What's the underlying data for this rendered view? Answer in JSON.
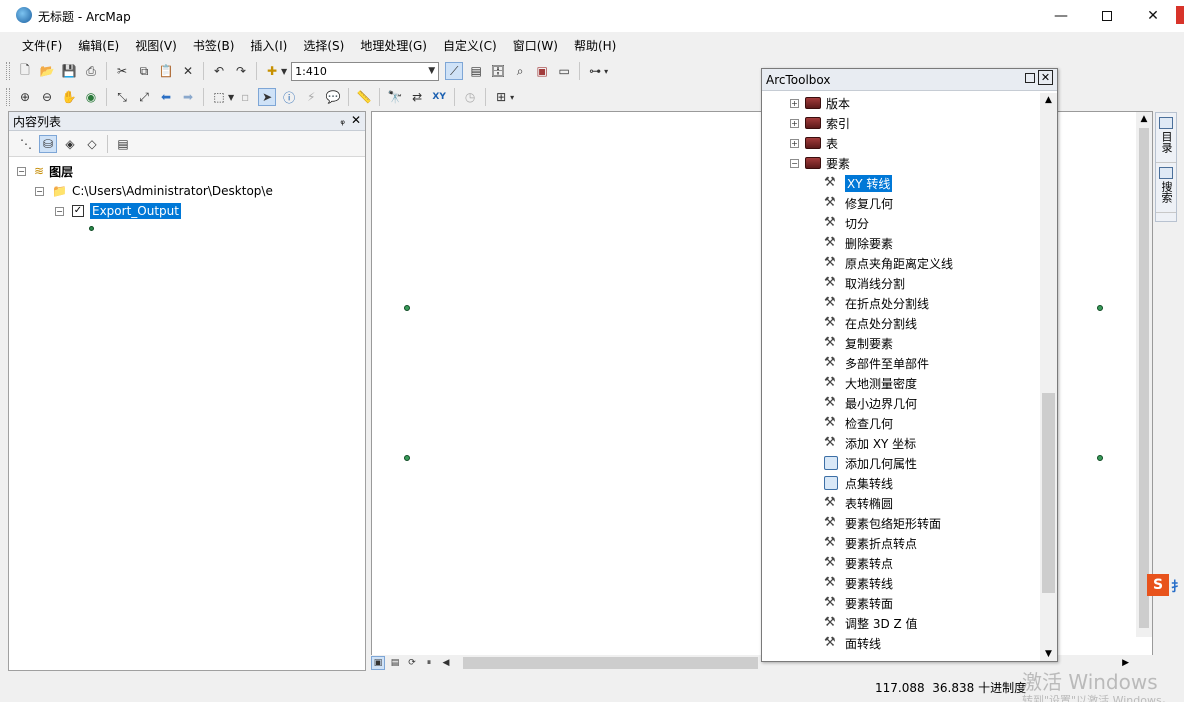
{
  "window": {
    "title": "无标题 - ArcMap"
  },
  "menu": [
    "文件(F)",
    "编辑(E)",
    "视图(V)",
    "书签(B)",
    "插入(I)",
    "选择(S)",
    "地理处理(G)",
    "自定义(C)",
    "窗口(W)",
    "帮助(H)"
  ],
  "toolbar": {
    "scale": "1:410"
  },
  "toc": {
    "title": "内容列表",
    "root": "图层",
    "folder": "C:\\Users\\Administrator\\Desktop\\e",
    "layer": "Export_Output",
    "layer_checked": true
  },
  "arctoolbox": {
    "title": "ArcToolbox",
    "toolsets": [
      "版本",
      "索引",
      "表",
      "要素"
    ],
    "tools": [
      {
        "label": "XY 转线",
        "icon": "hammer-icon",
        "selected": true
      },
      {
        "label": "修复几何",
        "icon": "hammer-icon"
      },
      {
        "label": "切分",
        "icon": "hammer-icon"
      },
      {
        "label": "删除要素",
        "icon": "hammer-icon"
      },
      {
        "label": "原点夹角距离定义线",
        "icon": "hammer-icon"
      },
      {
        "label": "取消线分割",
        "icon": "hammer-icon"
      },
      {
        "label": "在折点处分割线",
        "icon": "hammer-icon"
      },
      {
        "label": "在点处分割线",
        "icon": "hammer-icon"
      },
      {
        "label": "复制要素",
        "icon": "hammer-icon"
      },
      {
        "label": "多部件至单部件",
        "icon": "hammer-icon"
      },
      {
        "label": "大地测量密度",
        "icon": "hammer-icon"
      },
      {
        "label": "最小边界几何",
        "icon": "hammer-icon"
      },
      {
        "label": "检查几何",
        "icon": "hammer-icon"
      },
      {
        "label": "添加 XY 坐标",
        "icon": "hammer-icon"
      },
      {
        "label": "添加几何属性",
        "icon": "script-icon"
      },
      {
        "label": "点集转线",
        "icon": "script-icon"
      },
      {
        "label": "表转椭圆",
        "icon": "hammer-icon"
      },
      {
        "label": "要素包络矩形转面",
        "icon": "hammer-icon"
      },
      {
        "label": "要素折点转点",
        "icon": "hammer-icon"
      },
      {
        "label": "要素转点",
        "icon": "hammer-icon"
      },
      {
        "label": "要素转线",
        "icon": "hammer-icon"
      },
      {
        "label": "要素转面",
        "icon": "hammer-icon"
      },
      {
        "label": "调整 3D Z 值",
        "icon": "hammer-icon"
      },
      {
        "label": "面转线",
        "icon": "hammer-icon"
      }
    ]
  },
  "right_dock": [
    "目录",
    "搜索"
  ],
  "status": {
    "x": "117.088",
    "y": "36.838",
    "units": "十进制度"
  },
  "watermark": {
    "line1": "激活 Windows",
    "line2": "转到\"设置\"以激活 Windows。"
  }
}
